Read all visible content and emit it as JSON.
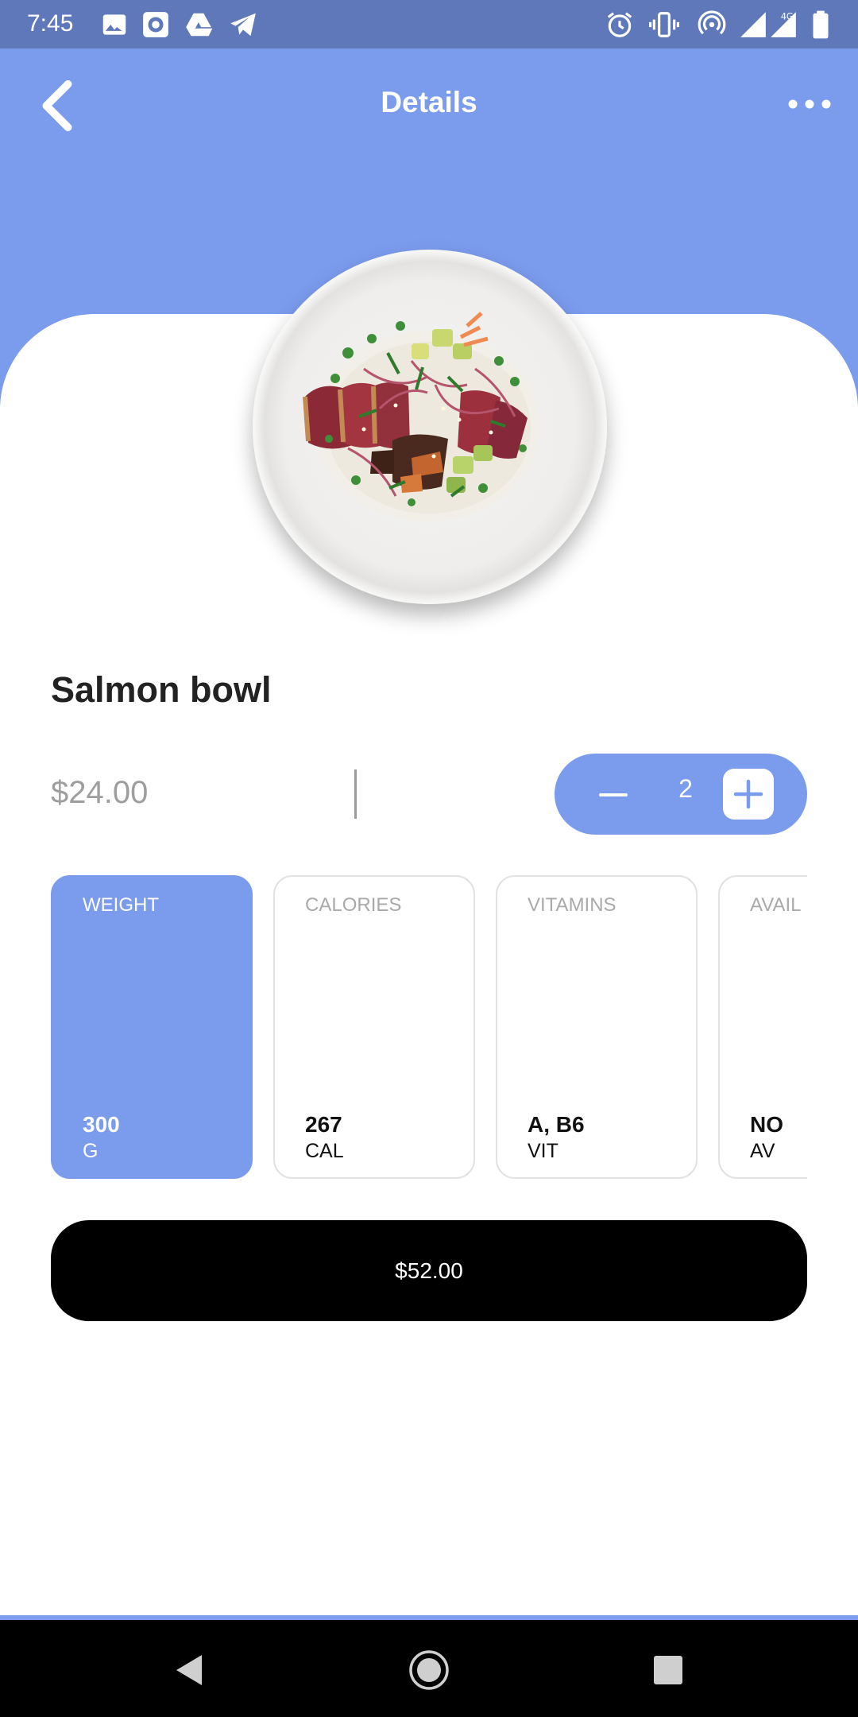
{
  "status_bar": {
    "time": "7:45",
    "icons": [
      "image-icon",
      "target-icon",
      "drive-icon",
      "telegram-icon",
      "alarm-icon",
      "vibrate-icon",
      "hotspot-icon",
      "signal-icon",
      "signal-4g-icon",
      "battery-icon"
    ],
    "network_label": "4G"
  },
  "header": {
    "title": "Details",
    "back_icon": "chevron-left-icon",
    "more_icon": "more-horizontal-icon",
    "color": "#7b9bed"
  },
  "product": {
    "name": "Salmon bowl",
    "price": "$24.00",
    "quantity": "2"
  },
  "stats": [
    {
      "label": "WEIGHT",
      "value": "300",
      "unit": "G",
      "active": true
    },
    {
      "label": "CALORIES",
      "value": "267",
      "unit": "CAL",
      "active": false
    },
    {
      "label": "VITAMINS",
      "value": "A, B6",
      "unit": "VIT",
      "active": false
    },
    {
      "label": "AVAIL",
      "value": "NO",
      "unit": "AV",
      "active": false
    }
  ],
  "total_button": {
    "label": "$52.00"
  },
  "nav": {
    "back_icon": "triangle-back-icon",
    "home_icon": "circle-home-icon",
    "recent_icon": "square-recents-icon"
  }
}
